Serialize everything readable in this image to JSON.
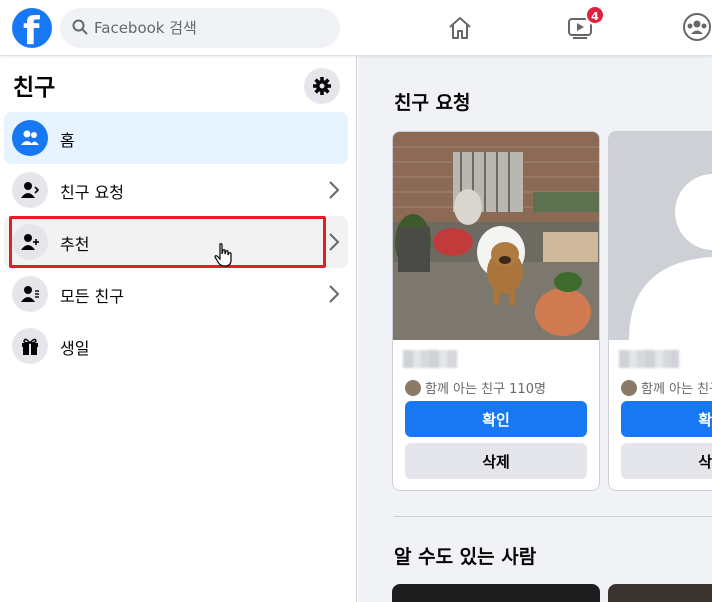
{
  "topbar": {
    "logo_letter": "f",
    "search_placeholder": "Facebook 검색",
    "watch_badge": "4"
  },
  "sidebar": {
    "title": "친구",
    "items": [
      {
        "label": "홈"
      },
      {
        "label": "친구 요청"
      },
      {
        "label": "추천"
      },
      {
        "label": "모든 친구"
      },
      {
        "label": "생일"
      }
    ]
  },
  "main": {
    "friend_requests_title": "친구 요청",
    "cards": [
      {
        "mutual": "함께 아는 친구 110명",
        "confirm": "확인",
        "delete": "삭제"
      },
      {
        "mutual": "함께 아는 친구",
        "confirm": "확인",
        "delete": "삭제"
      }
    ],
    "people_you_may_know_title": "알 수도 있는 사람"
  },
  "colors": {
    "brand": "#1877f2",
    "highlight": "#e31f26",
    "badge": "#e41e3f"
  }
}
